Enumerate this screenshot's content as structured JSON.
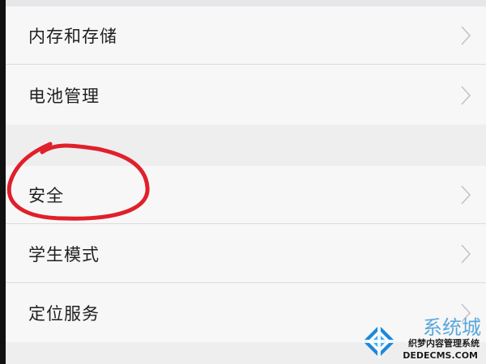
{
  "settings": {
    "group1": [
      {
        "label": "内存和存储"
      },
      {
        "label": "电池管理"
      }
    ],
    "group2": [
      {
        "label": "安全"
      },
      {
        "label": "学生模式"
      },
      {
        "label": "定位服务"
      }
    ]
  },
  "annotation": {
    "color": "#e0202a",
    "highlighted_item": "安全"
  },
  "watermark": {
    "brand": "系统城",
    "line1": "织梦内容管理系统",
    "line2": "DEDECMS.COM",
    "colors": {
      "blue": "#1e88d8",
      "text": "#1a1a1a"
    }
  }
}
